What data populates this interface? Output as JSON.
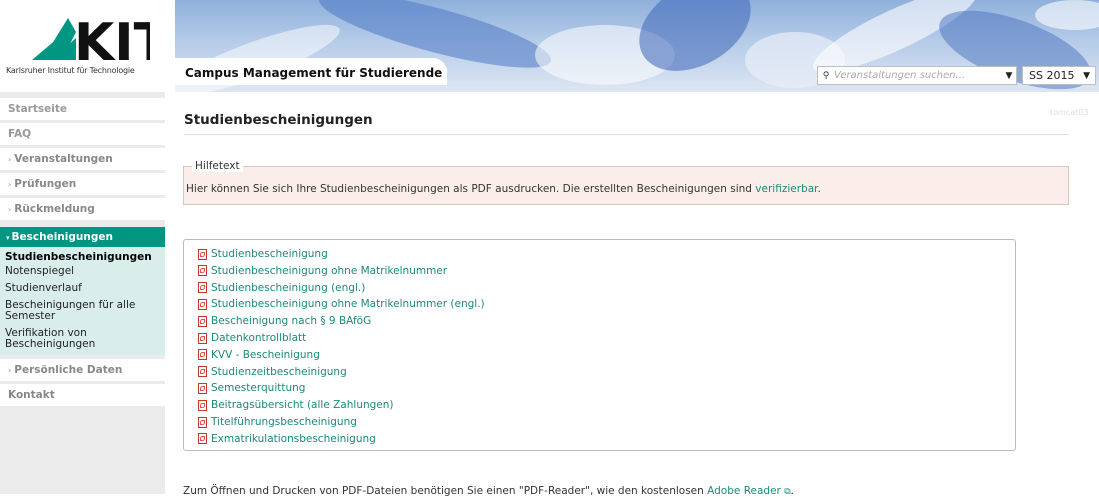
{
  "header": {
    "logo_text": "KIT",
    "logo_subtitle": "Karlsruher Institut für Technologie",
    "app_title": "Campus Management für Studierende",
    "search": {
      "placeholder": "Veranstaltungen suchen...",
      "icon": "search-icon"
    },
    "semester": {
      "value": "SS 2015"
    }
  },
  "sidebar": {
    "items_top": [
      {
        "label": "Startseite"
      },
      {
        "label": "FAQ"
      },
      {
        "label": "Veranstaltungen"
      },
      {
        "label": "Prüfungen"
      },
      {
        "label": "Rückmeldung"
      }
    ],
    "active_section": "Bescheinigungen",
    "sub_items": [
      {
        "label": "Studienbescheinigungen"
      },
      {
        "label": "Notenspiegel"
      },
      {
        "label": "Studienverlauf"
      },
      {
        "label": "Bescheinigungen für alle Semester"
      },
      {
        "label": "Verifikation von Bescheinigungen"
      }
    ],
    "items_bottom": [
      {
        "label": "Persönliche Daten"
      },
      {
        "label": "Kontakt"
      }
    ]
  },
  "main": {
    "title": "Studienbescheinigungen",
    "version": "tomcat03",
    "help": {
      "legend": "Hilfetext",
      "text": "Hier können Sie sich Ihre Studienbescheinigungen als PDF ausdrucken. Die erstellten Bescheinigungen sind ",
      "link": "verifizierbar",
      "suffix": "."
    },
    "documents": [
      "Studienbescheinigung",
      "Studienbescheinigung ohne Matrikelnummer",
      "Studienbescheinigung (engl.)",
      "Studienbescheinigung ohne Matrikelnummer (engl.)",
      "Bescheinigung nach § 9 BAföG",
      "Datenkontrollblatt",
      "KVV - Bescheinigung",
      "Studienzeitbescheinigung",
      "Semesterquittung",
      "Beitragsübersicht (alle Zahlungen)",
      "Titelführungsbescheinigung",
      "Exmatrikulationsbescheinigung"
    ],
    "footer": {
      "text": "Zum Öffnen und Drucken von PDF-Dateien benötigen Sie einen \"PDF-Reader\", wie den kostenlosen ",
      "link": "Adobe Reader",
      "suffix": "."
    }
  },
  "colors": {
    "accent": "#009682",
    "link": "#1a8a79",
    "help_bg": "#fbeeea"
  }
}
